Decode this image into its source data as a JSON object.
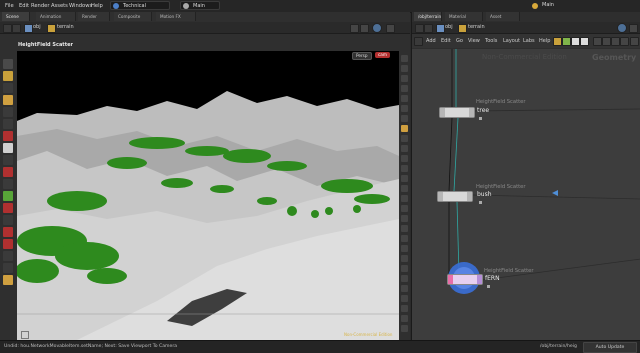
{
  "menubar": {
    "items": [
      "File",
      "Edit",
      "Render",
      "Assets",
      "Windows",
      "Help"
    ],
    "desktop": "Technical",
    "secondary": "Main",
    "right": "Main"
  },
  "left_pane": {
    "tabs": [
      "Scene View",
      "Animation Editor",
      "Render View",
      "Composite View",
      "Motion FX View"
    ],
    "path": {
      "obj": "obj",
      "node": "terrain"
    },
    "viewport": {
      "title": "HeightField Scatter",
      "camera": "Persp",
      "cam_menu": "cam",
      "footer": "Non-Commercial Edition"
    }
  },
  "right_pane": {
    "tabs": [
      "/obj/terrain",
      "Material Palette",
      "Asset Browser"
    ],
    "path": {
      "obj": "obj",
      "node": "terrain"
    },
    "menu": [
      "Add",
      "Edit",
      "Go",
      "View",
      "Tools",
      "Layout",
      "Labs",
      "Help"
    ],
    "network": {
      "watermark": "Non-Commercial Edition",
      "context": "Geometry",
      "nodes": [
        {
          "type": "HeightField Scatter",
          "name": "tree"
        },
        {
          "type": "HeightField Scatter",
          "name": "bush"
        },
        {
          "type": "HeightField Scatter",
          "name": "fERN"
        }
      ]
    }
  },
  "statusbar": {
    "message": "Undid: hou.NetworkMovableItem.setName; Next: Save Viewport To Camera",
    "path": "/obj/terrain/heig",
    "auto_update": "Auto Update"
  },
  "colors": {
    "foliage": "#2e8a1e",
    "terrain": "#c9c9c9",
    "node_fill": "#d9d9d9",
    "display_flag": "#3a6fd8",
    "accent_link": "#4f8fd8"
  }
}
